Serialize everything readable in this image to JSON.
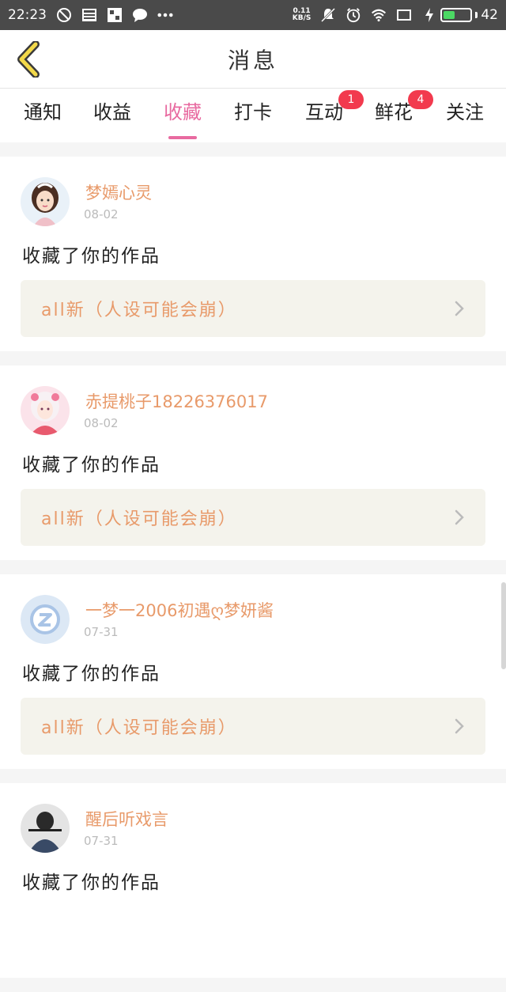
{
  "status_bar": {
    "time": "22:23",
    "speed_value": "0.11",
    "speed_unit": "KB/S",
    "battery": "42"
  },
  "header": {
    "title": "消息"
  },
  "tabs": [
    {
      "label": "通知",
      "badge": ""
    },
    {
      "label": "收益",
      "badge": ""
    },
    {
      "label": "收藏",
      "badge": "",
      "active": true
    },
    {
      "label": "打卡",
      "badge": ""
    },
    {
      "label": "互动",
      "badge": "1"
    },
    {
      "label": "鲜花",
      "badge": "4"
    },
    {
      "label": "关注",
      "badge": ""
    }
  ],
  "messages": [
    {
      "user": "梦嫣心灵",
      "date": "08-02",
      "action": "收藏了你的作品",
      "work": "all新（人设可能会崩）"
    },
    {
      "user": "赤提桃子18226376017",
      "date": "08-02",
      "action": "收藏了你的作品",
      "work": "all新（人设可能会崩）"
    },
    {
      "user": "一梦一2006初遇ღ梦妍酱",
      "date": "07-31",
      "action": "收藏了你的作品",
      "work": "all新（人设可能会崩）"
    },
    {
      "user": "醒后听戏言",
      "date": "07-31",
      "action": "收藏了你的作品",
      "work": ""
    }
  ],
  "colors": {
    "accent": "#e86aa0",
    "username": "#e89a6a",
    "badge": "#f23a4e"
  }
}
